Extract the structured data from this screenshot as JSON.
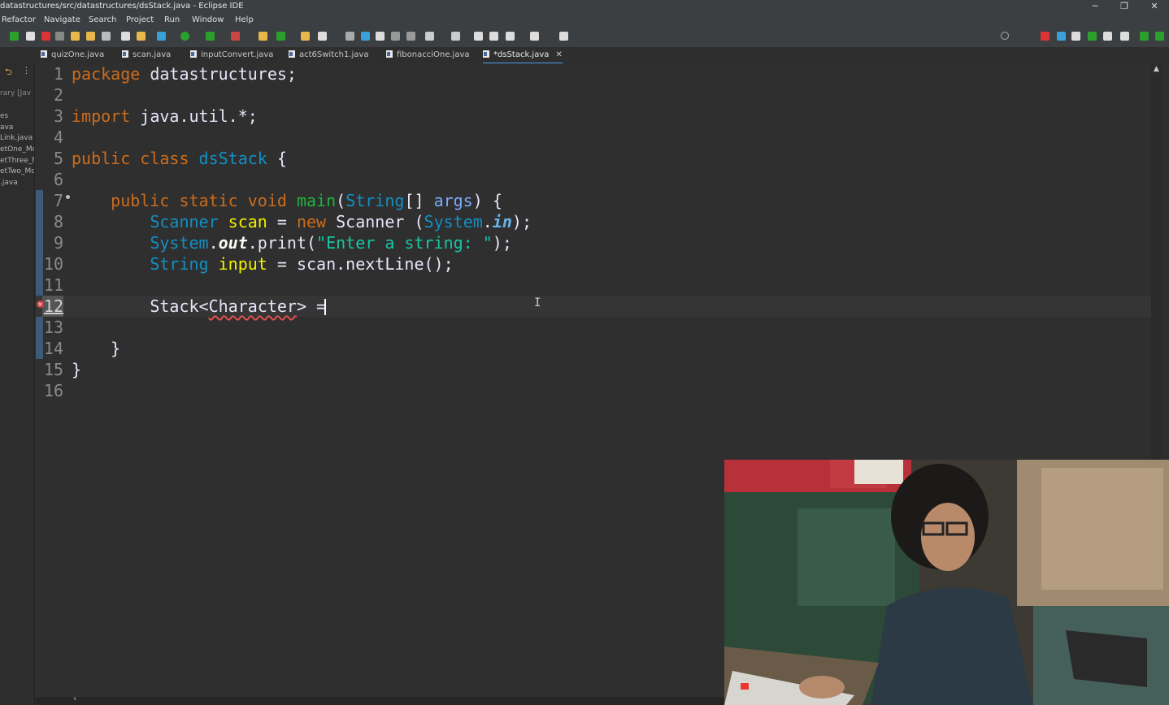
{
  "window": {
    "title": "datastructures/src/datastructures/dsStack.java - Eclipse IDE",
    "controls": [
      "─",
      "❐",
      "✕"
    ]
  },
  "menu": [
    "Refactor",
    "Navigate",
    "Search",
    "Project",
    "Run",
    "Window",
    "Help"
  ],
  "tabs": [
    {
      "label": "quizOne.java",
      "active": false
    },
    {
      "label": "scan.java",
      "active": false
    },
    {
      "label": "inputConvert.java",
      "active": false
    },
    {
      "label": "act6Switch1.java",
      "active": false
    },
    {
      "label": "fibonacciOne.java",
      "active": false
    },
    {
      "label": "*dsStack.java",
      "active": true
    }
  ],
  "tab_close": "✕",
  "left_panel": {
    "header_icons": [
      "⮌",
      "⋮"
    ],
    "items": [
      "rary [Jav",
      "es",
      "ava",
      "Link.java",
      "etOne_Mc",
      "etThree_f",
      "etTwo_Mc",
      ".java"
    ]
  },
  "editor": {
    "line_numbers": [
      "1",
      "2",
      "3",
      "4",
      "5",
      "6",
      "7",
      "8",
      "9",
      "10",
      "11",
      "12",
      "13",
      "14",
      "15",
      "16"
    ],
    "current_line": 12,
    "error_line": 12,
    "code": {
      "l1": {
        "kw": "package",
        "rest": " datastructures;"
      },
      "l3": {
        "kw": "import",
        "rest": " java.util.*;"
      },
      "l5": {
        "kw": "public class",
        "name": "dsStack",
        "rest": " {"
      },
      "l7": {
        "kw": "public static void",
        "fn": "main",
        "p1": "(",
        "type": "String",
        "p2": "[] ",
        "arg": "args",
        "p3": ") {"
      },
      "l8": {
        "type": "Scanner",
        "var": "scan",
        "p1": " = ",
        "kw": "new",
        "ctor": "Scanner",
        "p2": " (",
        "cls": "System",
        "dot": ".",
        "fld": "in",
        "p3": ");"
      },
      "l9": {
        "cls": "System",
        "dot": ".",
        "fld": "out",
        "call": ".print(",
        "str": "\"Enter a string: \"",
        "end": ");"
      },
      "l10": {
        "type": "String",
        "var": "input",
        "rest": " = scan.nextLine();"
      },
      "l12": {
        "generic_open": "Stack<",
        "generic_inner": "Character",
        "generic_close": ">",
        "rest": " ="
      },
      "l14": {
        "rest": "}"
      },
      "l15": {
        "rest": "}"
      }
    }
  },
  "colors": {
    "keyword": "#cc6c1d",
    "type": "#1290c3",
    "method": "#1eb540",
    "variable": "#f2f200",
    "string": "#17c6a3",
    "editor_bg": "#2f2f2f"
  },
  "webcam": {
    "description_icon": "webcam-overlay"
  }
}
